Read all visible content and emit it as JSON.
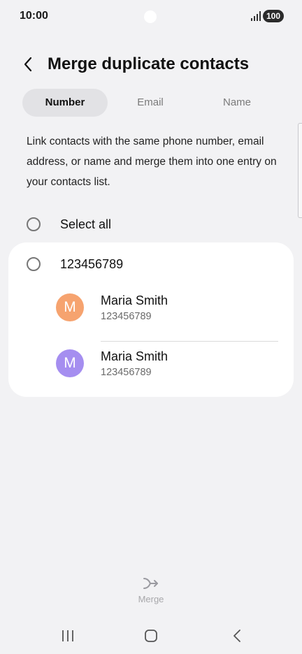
{
  "status_bar": {
    "time": "10:00",
    "battery": "100"
  },
  "header": {
    "title": "Merge duplicate contacts"
  },
  "tabs": [
    {
      "label": "Number",
      "active": true
    },
    {
      "label": "Email",
      "active": false
    },
    {
      "label": "Name",
      "active": false
    }
  ],
  "description": "Link contacts with the same phone number, email address, or name and merge them into one entry on your contacts list.",
  "select_all": {
    "label": "Select all"
  },
  "group": {
    "title": "123456789",
    "contacts": [
      {
        "initial": "M",
        "name": "Maria Smith",
        "number": "123456789",
        "color": "#f6a36f"
      },
      {
        "initial": "M",
        "name": "Maria Smith",
        "number": "123456789",
        "color": "#a58ef0"
      }
    ]
  },
  "merge": {
    "label": "Merge"
  },
  "icons": {
    "back": "chevron-left-icon",
    "merge": "merge-arrows-icon",
    "nav_recents": "recents-icon",
    "nav_home": "home-icon",
    "nav_back": "back-icon"
  }
}
